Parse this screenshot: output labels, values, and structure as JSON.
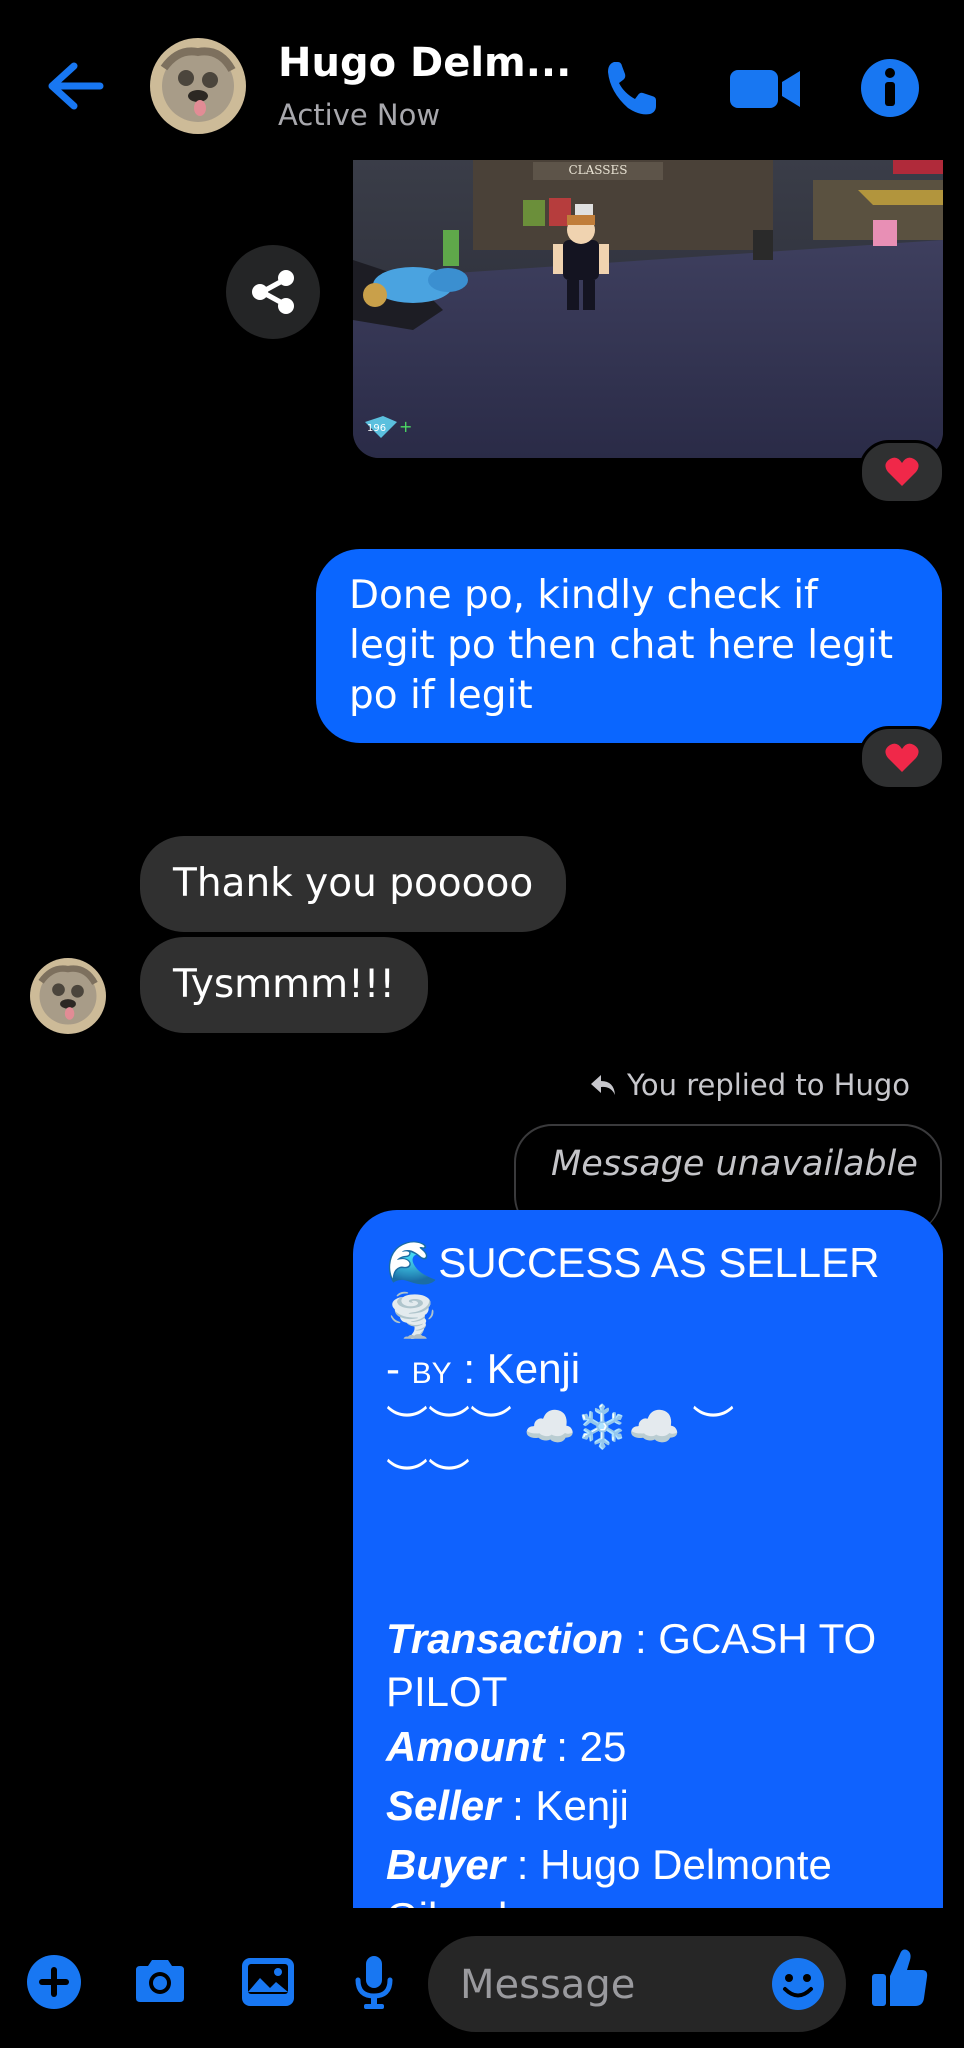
{
  "header": {
    "contact_name": "Hugo Delm...",
    "status": "Active Now",
    "accent_color": "#1877f2",
    "icons": [
      "back-arrow-icon",
      "phone-icon",
      "video-camera-icon",
      "info-icon"
    ]
  },
  "attachment": {
    "sign_text": "CLASSES",
    "badge_count": "196",
    "reaction": "heart"
  },
  "messages": [
    {
      "from": "me",
      "text": "Done po, kindly check if legit po then chat here legit po if legit",
      "reaction": "heart"
    },
    {
      "from": "them",
      "text": "Thank you pooooo"
    },
    {
      "from": "them",
      "text": "Tysmmm!!!"
    }
  ],
  "reply": {
    "label": "You replied to Hugo",
    "quoted": "Message unavailable"
  },
  "receipt": {
    "title": "🌊SUCCESS AS SELLER🌪️",
    "byline_prefix": "- ",
    "byline_small": "BY",
    "byline_suffix": " : Kenji",
    "decor_line1": "︶︶︶ ☁️❄️☁️ ︶",
    "decor_line2": "︶︶",
    "rows": [
      {
        "label": "Transaction",
        "value": " : GCASH TO PILOT"
      },
      {
        "label": "Amount",
        "value": " : 25"
      },
      {
        "label": "Seller",
        "value": " : Kenji"
      },
      {
        "label": "Buyer",
        "value": " : Hugo Delmonte Gilgadon"
      }
    ]
  },
  "composer": {
    "placeholder": "Message",
    "icons": [
      "plus-icon",
      "camera-icon",
      "gallery-icon",
      "microphone-icon",
      "emoji-icon",
      "thumbs-up-icon"
    ]
  }
}
